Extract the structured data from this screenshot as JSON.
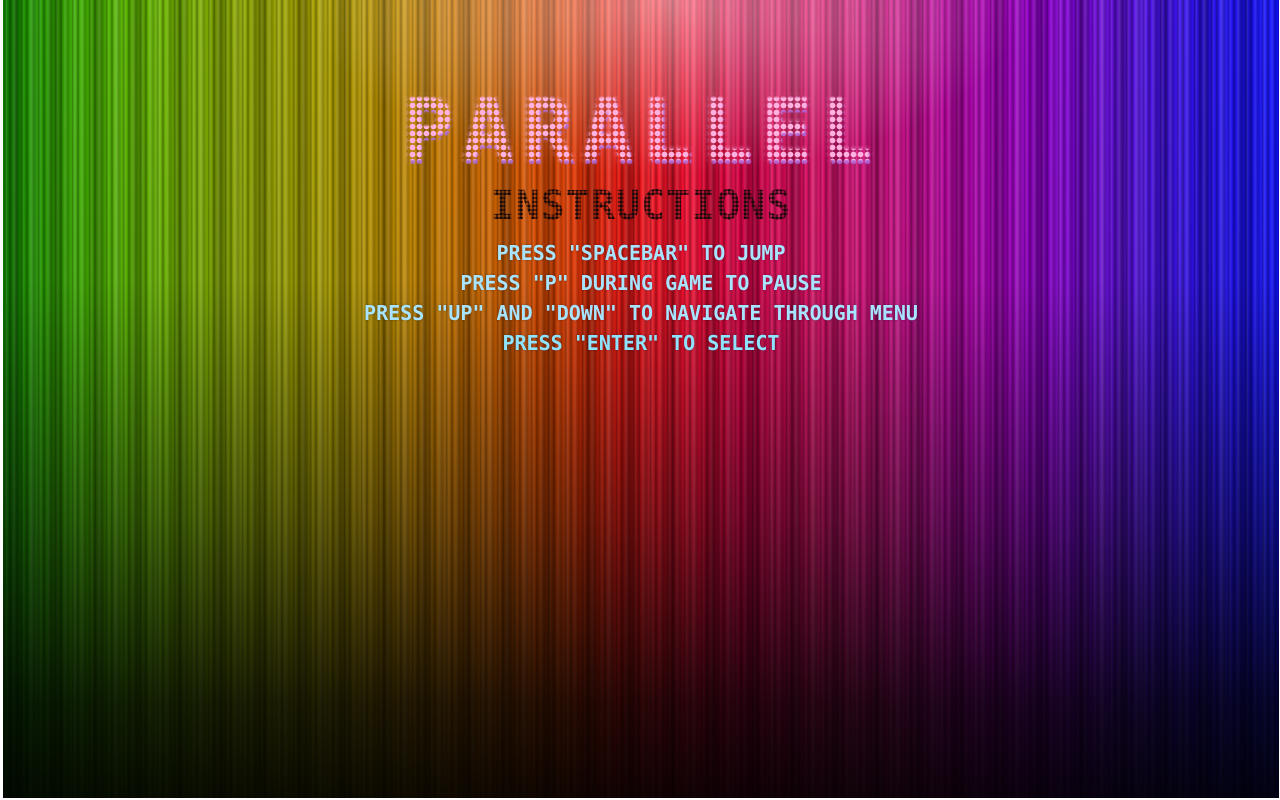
{
  "game": {
    "title": "PARALLEL"
  },
  "screen": {
    "heading": "INSTRUCTIONS",
    "instructions": [
      "PRESS \"SPACEBAR\" TO JUMP",
      "PRESS \"P\" DURING GAME TO PAUSE",
      "PRESS \"UP\" AND \"DOWN\" TO NAVIGATE THROUGH MENU",
      "PRESS \"ENTER\" TO SELECT"
    ]
  },
  "colors": {
    "title_pink": "#ffb2e0",
    "title_shadow_violet": "#a064e6",
    "heading": "#1a0a0a",
    "instruction_text": "#a8e4ff",
    "spectrum": [
      "#0f8a00",
      "#c88a00",
      "#f01a10",
      "#e0106a",
      "#8a00d0",
      "#1010ff"
    ]
  }
}
